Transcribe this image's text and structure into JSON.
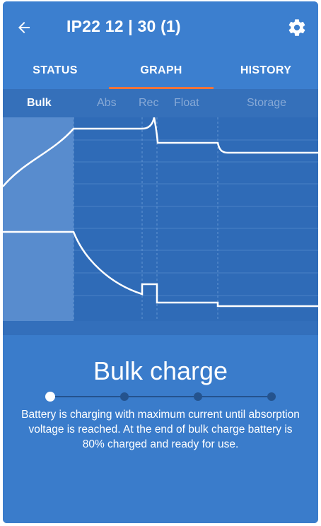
{
  "header": {
    "title": "IP22 12 | 30 (1)",
    "back_icon": "arrow-left-icon",
    "settings_icon": "gear-icon"
  },
  "tabs": [
    {
      "label": "STATUS",
      "active": false
    },
    {
      "label": "GRAPH",
      "active": true
    },
    {
      "label": "HISTORY",
      "active": false
    }
  ],
  "phases": [
    {
      "label": "Bulk",
      "active": true
    },
    {
      "label": "Abs",
      "active": false
    },
    {
      "label": "Rec",
      "active": false
    },
    {
      "label": "Float",
      "active": false
    },
    {
      "label": "Storage",
      "active": false
    }
  ],
  "description": {
    "title": "Bulk charge",
    "text": "Battery is charging with maximum current until absorption voltage is reached. At the end of bulk charge battery is 80% charged and ready for use.",
    "step_count": 4,
    "active_step": 1
  },
  "colors": {
    "accent": "#f0743a",
    "primary": "#3c7fcf",
    "graph_bg": "#2f6bb7",
    "graph_highlight": "#6a9ad7"
  }
}
